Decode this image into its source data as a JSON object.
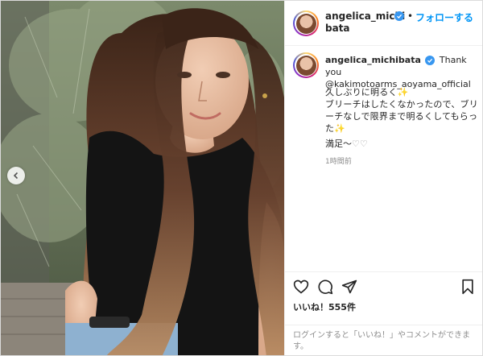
{
  "post": {
    "username": "angelica_michibata",
    "username_line1": "angelica_michi",
    "username_line2": "bata",
    "follow_separator": "•",
    "follow_label": "フォローする",
    "caption_mention": "Thank you\n@kakimotoarms_aoyama_official",
    "caption_line1": "久しぶりに明るく",
    "caption_line2": "ブリーチはしたくなかったので、ブリーチなしで限界まで明るくしてもらった",
    "caption_line3": "満足〜",
    "sparkle": "✨",
    "hearts": "♡♡",
    "heart_single": "♡",
    "time": "1時間前",
    "likes": "いいね！555件",
    "login_prompt": "ログインすると「いいね！」やコメントができます。"
  },
  "colors": {
    "follow": "#0095f6",
    "verified": "#3897f0",
    "text": "#262626",
    "muted": "#8e8e8e"
  },
  "icons": {
    "like": "heart-outline-icon",
    "comment": "comment-bubble-icon",
    "share": "paper-plane-icon",
    "save": "bookmark-icon",
    "carousel": "chevron-left-icon",
    "verified": "verified-badge-icon"
  }
}
